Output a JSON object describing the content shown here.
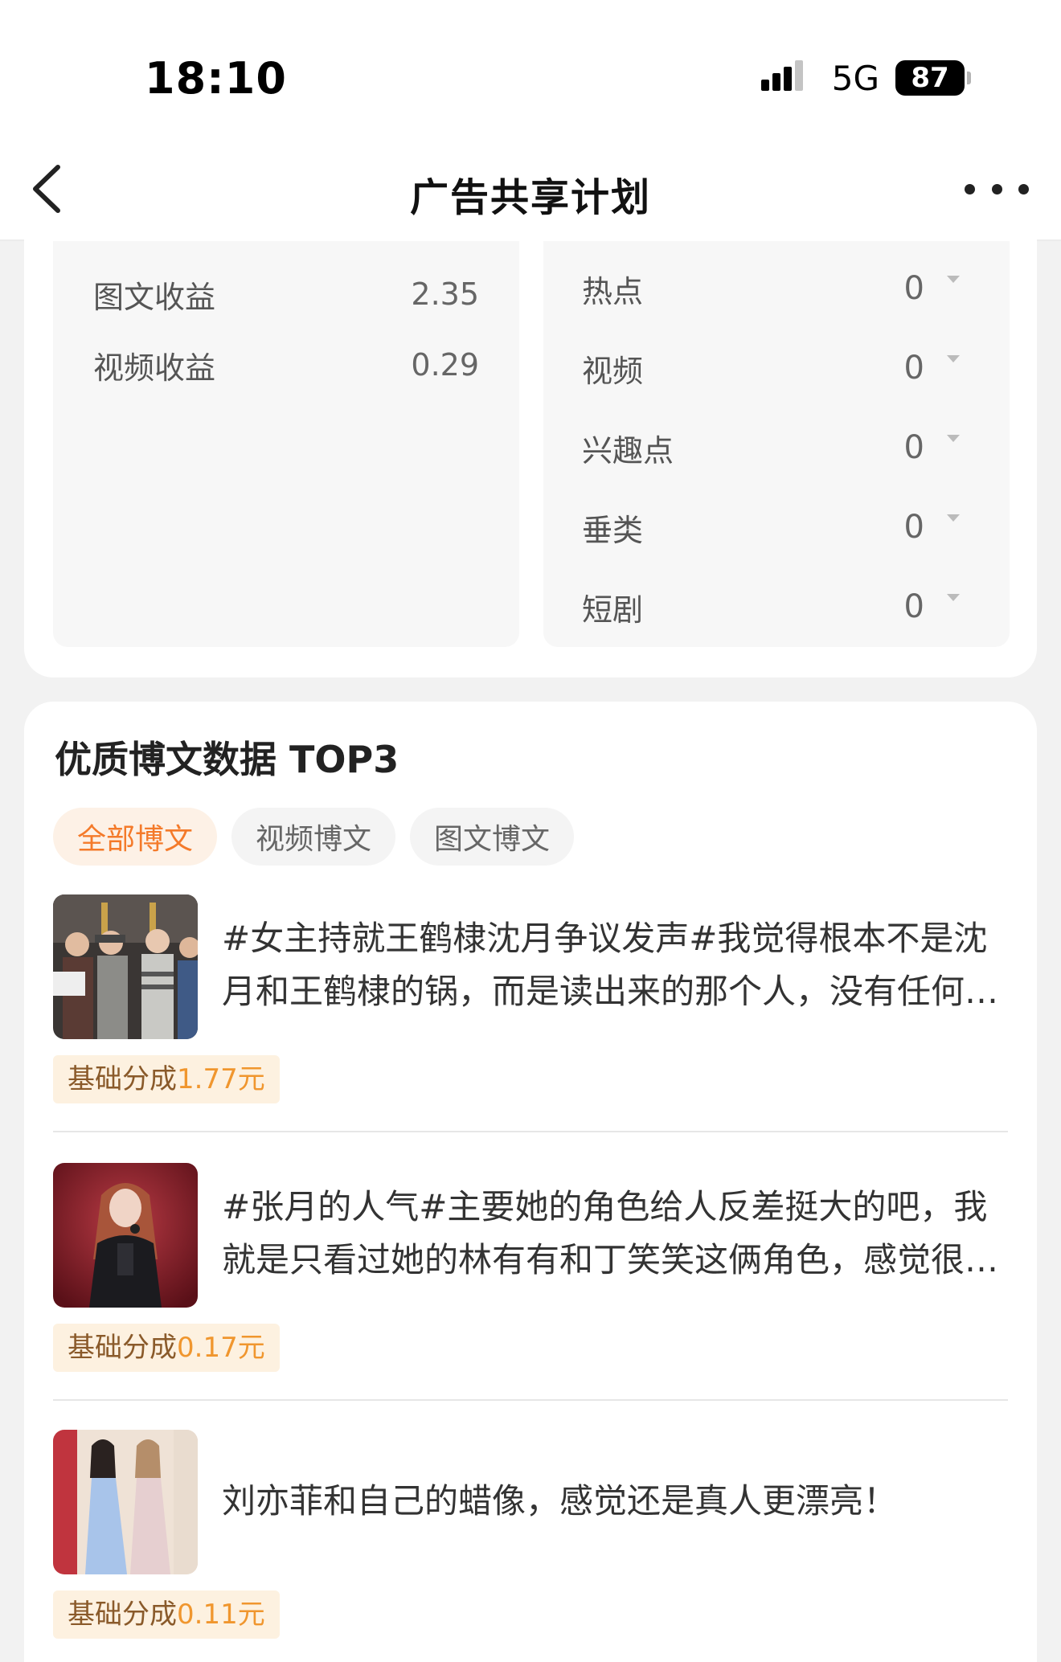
{
  "status_bar": {
    "time": "18:10",
    "network": "5G",
    "battery": "87"
  },
  "nav": {
    "title": "广告共享计划"
  },
  "income": [
    {
      "label": "图文收益",
      "value": "2.35"
    },
    {
      "label": "视频收益",
      "value": "0.29"
    }
  ],
  "categories": [
    {
      "label": "热点",
      "value": "0"
    },
    {
      "label": "视频",
      "value": "0"
    },
    {
      "label": "兴趣点",
      "value": "0"
    },
    {
      "label": "垂类",
      "value": "0"
    },
    {
      "label": "短剧",
      "value": "0"
    }
  ],
  "top_posts": {
    "title": "优质博文数据 TOP3",
    "tabs": [
      "全部博文",
      "视频博文",
      "图文博文"
    ],
    "active_tab": "全部博文",
    "badge_prefix": "基础分成",
    "badge_suffix": "元",
    "items": [
      {
        "text": "#女主持就王鹤棣沈月争议发声#我觉得根本不是沈月和王鹤棣的锅，而是读出来的那个人，没有任何不知道事情真实情况就乱说话",
        "amount": "1.77"
      },
      {
        "text": "#张月的人气#主要她的角色给人反差挺大的吧，我就是只看过她的林有有和丁笑笑这俩角色，感觉很有意思",
        "amount": "0.17"
      },
      {
        "text": "刘亦菲和自己的蜡像，感觉还是真人更漂亮！",
        "amount": "0.11"
      }
    ]
  },
  "colors": {
    "accent": "#f47a2a",
    "badge_bg": "#fdf1e0",
    "badge_amount": "#f0962e"
  }
}
